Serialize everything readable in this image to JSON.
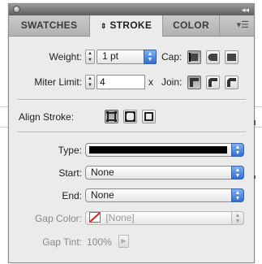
{
  "tabs": [
    {
      "label": "SWATCHES",
      "active": false
    },
    {
      "label": "STROKE",
      "active": true,
      "icon": "updown-arrows-icon"
    },
    {
      "label": "COLOR",
      "active": false
    }
  ],
  "stroke": {
    "weight_label": "Weight:",
    "weight_value": "1 pt",
    "cap_label": "Cap:",
    "miter_label": "Miter Limit:",
    "miter_value": "4",
    "miter_unit": "x",
    "join_label": "Join:",
    "align_label": "Align Stroke:",
    "type_label": "Type:",
    "start_label": "Start:",
    "start_value": "None",
    "end_label": "End:",
    "end_value": "None",
    "gap_color_label": "Gap Color:",
    "gap_color_value": "[None]",
    "gap_tint_label": "Gap Tint:",
    "gap_tint_value": "100%"
  },
  "colors": {
    "accent": "#2e6fd8",
    "none_slash": "#e02020"
  }
}
